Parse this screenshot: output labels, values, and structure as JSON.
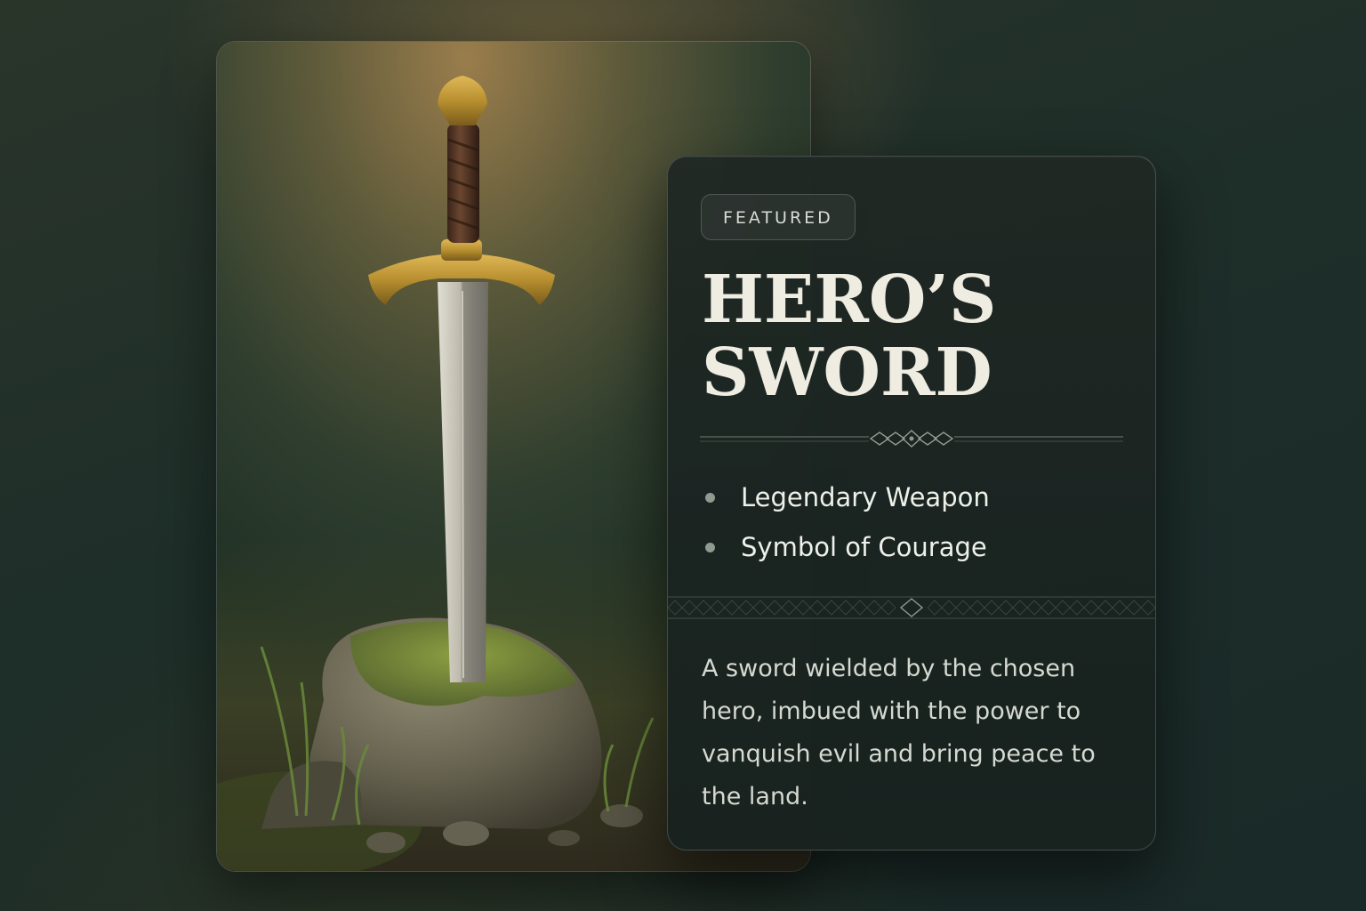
{
  "card": {
    "badge": "FEATURED",
    "title_line1": "HERO’S",
    "title_line2": "SWORD",
    "features": [
      {
        "label": "Legendary Weapon"
      },
      {
        "label": "Symbol of Courage"
      }
    ],
    "description": "A sword wielded by the chosen hero, imbued with the power to vanquish evil and bring peace to the land."
  },
  "image": {
    "subject": "sword-in-stone"
  },
  "colors": {
    "background": "#1e2e29",
    "card": "#1e2a26",
    "title": "#efece1",
    "gold": "#b8902f",
    "moss": "#6f8a32",
    "bullet": "#8f9a90"
  }
}
